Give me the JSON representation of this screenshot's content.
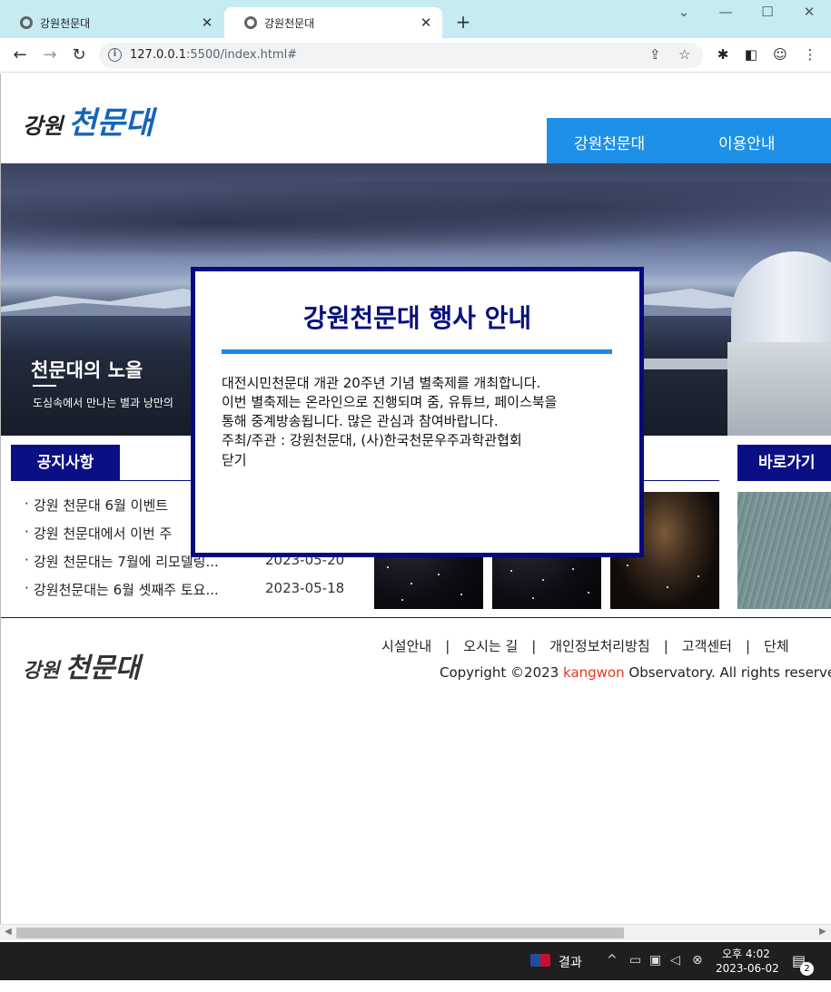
{
  "browser": {
    "tabs": [
      {
        "title": "강원천문대",
        "active": false
      },
      {
        "title": "강원천문대",
        "active": true
      }
    ],
    "new_tab_label": "+",
    "url_host": "127.0.0.1",
    "url_rest": ":5500/index.html#",
    "window_controls": [
      "⌄",
      "—",
      "☐",
      "✕"
    ]
  },
  "site": {
    "logo_part1": "강원",
    "logo_part2": "천문대",
    "nav": [
      "강원천문대",
      "이용안내"
    ],
    "hero": {
      "title": "천문대의 노을",
      "subtitle": "도심속에서 만나는 별과 낭만의"
    },
    "notice": {
      "heading": "공지사항",
      "items": [
        {
          "title": "강원 천문대 6월 이벤트",
          "date": ""
        },
        {
          "title": "강원 천문대에서 이번 주",
          "date": ""
        },
        {
          "title": "강원 천문대는 7월에 리모델링...",
          "date": "2023-05-20"
        },
        {
          "title": "강원천문대는 6월 셋째주 토요...",
          "date": "2023-05-18"
        }
      ]
    },
    "shortcut": {
      "heading": "바로가기"
    },
    "footer": {
      "logo_part1": "강원",
      "logo_part2": "천문대",
      "links": [
        "시설안내",
        "오시는 길",
        "개인정보처리방침",
        "고객센터",
        "단체"
      ],
      "copyright_prefix": "Copyright ©2023 ",
      "copyright_brand": "kangwon",
      "copyright_suffix": " Observatory. All rights reserved"
    }
  },
  "modal": {
    "title": "강원천문대 행사 안내",
    "lines": [
      "대전시민천문대 개관 20주년 기념 별축제를 개최합니다.",
      "이번 별축제는 온라인으로 진행되며 줌, 유튜브, 페이스북을",
      "통해 중계방송됩니다. 많은 관심과 참여바랍니다.",
      "주최/주관 : 강원천문대, (사)한국천문우주과학관협회"
    ],
    "close_label": "닫기"
  },
  "taskbar": {
    "app_label": "결과",
    "time": "오후 4:02",
    "date": "2023-06-02",
    "notification_count": "2"
  },
  "colors": {
    "navy": "#0b0f86",
    "nav_blue": "#1e90e8",
    "modal_bar": "#1e88e5",
    "brand_red": "#e03a1e"
  }
}
